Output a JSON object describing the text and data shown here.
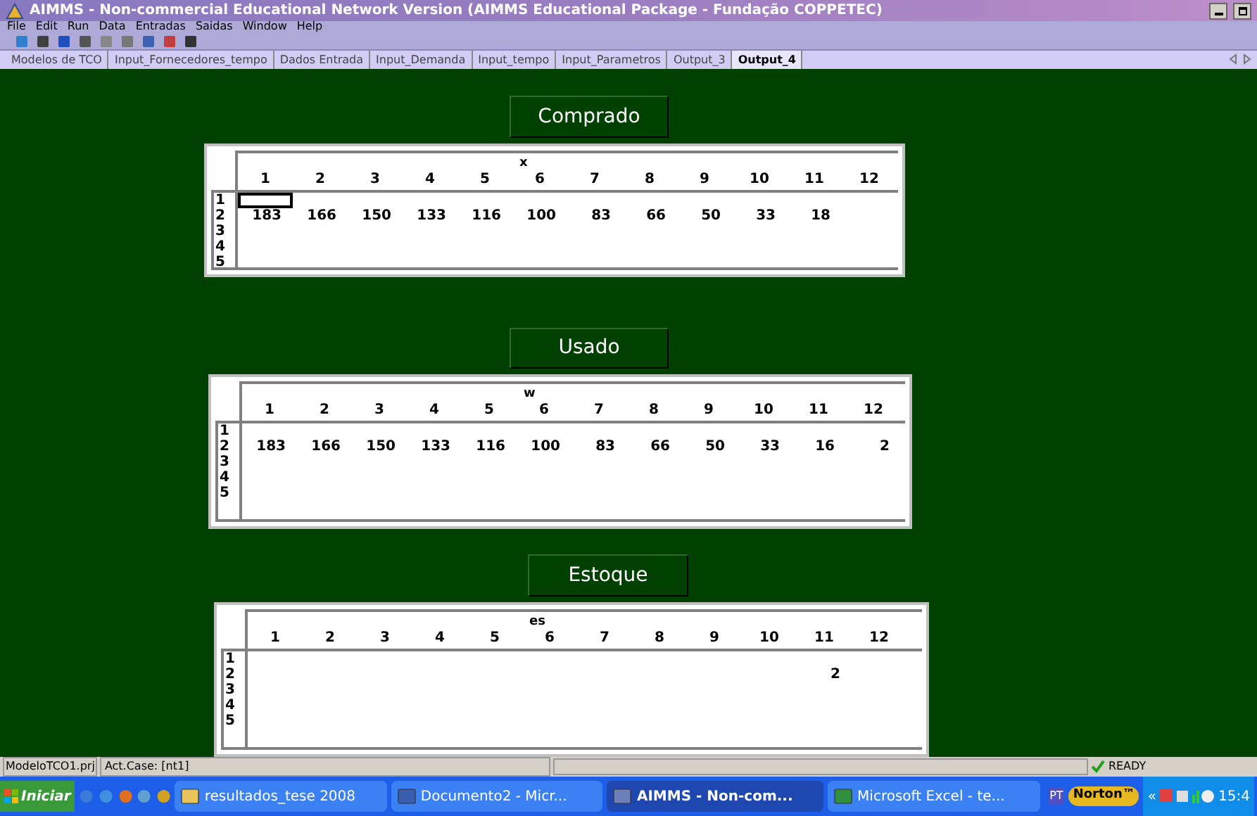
{
  "window": {
    "title": "AIMMS - Non-commercial Educational Network Version (AIMMS Educational Package - Fundação COPPETEC)"
  },
  "menu": [
    "File",
    "Edit",
    "Run",
    "Data",
    "Entradas",
    "Saidas",
    "Window",
    "Help"
  ],
  "tabs": [
    {
      "label": "Modelos de TCO",
      "selected": false
    },
    {
      "label": "Input_Fornecedores_tempo",
      "selected": false
    },
    {
      "label": "Dados Entrada",
      "selected": false
    },
    {
      "label": "Input_Demanda",
      "selected": false
    },
    {
      "label": "Input_tempo",
      "selected": false
    },
    {
      "label": "Input_Parametros",
      "selected": false
    },
    {
      "label": "Output_3",
      "selected": false
    },
    {
      "label": "Output_4",
      "selected": true
    }
  ],
  "panels": [
    {
      "title": "Comprado",
      "table": {
        "index_label": "x",
        "columns": [
          "1",
          "2",
          "3",
          "4",
          "5",
          "6",
          "7",
          "8",
          "9",
          "10",
          "11",
          "12"
        ],
        "rows": [
          {
            "label": "1",
            "cells": [
              {
                "selected": true
              }
            ]
          },
          {
            "label": "2",
            "cells": [
              {
                "value": "183"
              },
              {
                "value": "166"
              },
              {
                "value": "150"
              },
              {
                "value": "133"
              },
              {
                "value": "116"
              },
              {
                "value": "100"
              },
              {
                "value": "83"
              },
              {
                "value": "66"
              },
              {
                "value": "50"
              },
              {
                "value": "33"
              },
              {
                "value": "18"
              }
            ]
          },
          {
            "label": "3"
          },
          {
            "label": "4"
          },
          {
            "label": "5"
          }
        ]
      }
    },
    {
      "title": "Usado",
      "table": {
        "index_label": "w",
        "columns": [
          "1",
          "2",
          "3",
          "4",
          "5",
          "6",
          "7",
          "8",
          "9",
          "10",
          "11",
          "12"
        ],
        "rows": [
          {
            "label": "1"
          },
          {
            "label": "2",
            "cells": [
              {
                "value": "183"
              },
              {
                "value": "166"
              },
              {
                "value": "150"
              },
              {
                "value": "133"
              },
              {
                "value": "116"
              },
              {
                "value": "100"
              },
              {
                "value": "83"
              },
              {
                "value": "66"
              },
              {
                "value": "50"
              },
              {
                "value": "33"
              },
              {
                "value": "16"
              },
              {
                "value": "2"
              }
            ]
          },
          {
            "label": "3"
          },
          {
            "label": "4"
          },
          {
            "label": "5"
          }
        ]
      }
    },
    {
      "title": "Estoque",
      "table": {
        "index_label": "es",
        "columns": [
          "1",
          "2",
          "3",
          "4",
          "5",
          "6",
          "7",
          "8",
          "9",
          "10",
          "11",
          "12"
        ],
        "rows": [
          {
            "label": "1"
          },
          {
            "label": "2",
            "cells": [
              null,
              null,
              null,
              null,
              null,
              null,
              null,
              null,
              null,
              null,
              {
                "value": "2"
              }
            ]
          },
          {
            "label": "3"
          },
          {
            "label": "4"
          },
          {
            "label": "5"
          }
        ]
      }
    }
  ],
  "status_bar": {
    "project": "ModeloTCO1.prj",
    "case": "Act.Case: [nt1]",
    "state": "READY"
  },
  "taskbar": {
    "start": "Iniciar",
    "tasks": [
      {
        "label": "resultados_tese 2008",
        "kind": "folder",
        "selected": false
      },
      {
        "label": "Documento2 - Micr...",
        "kind": "word",
        "selected": false
      },
      {
        "label": "AIMMS - Non-com...",
        "kind": "aimms",
        "selected": true
      },
      {
        "label": "Microsoft Excel - te...",
        "kind": "excel",
        "selected": false
      }
    ],
    "language": "PT",
    "norton": "Norton™",
    "chevron": "«",
    "clock": "15:4"
  }
}
